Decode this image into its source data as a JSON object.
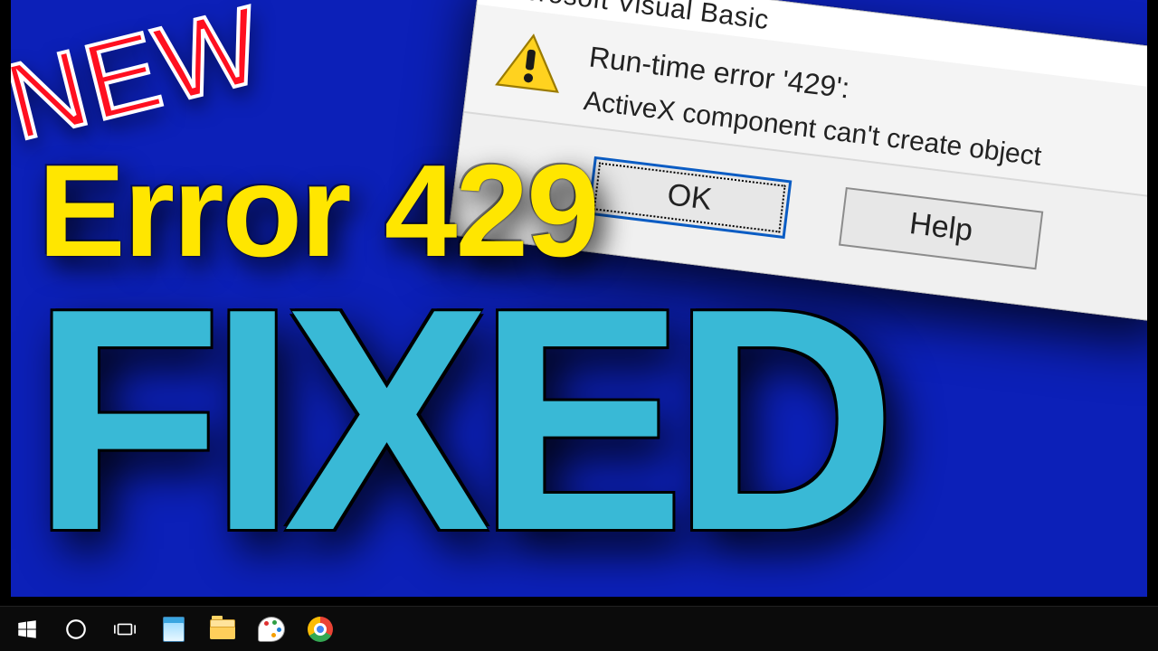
{
  "overlay": {
    "badge": "NEW",
    "headline1": "Error 429",
    "headline2": "FIXED"
  },
  "dialog": {
    "title": "Microsoft Visual Basic",
    "close_glyph": "✕",
    "error_heading": "Run-time error '429':",
    "error_body": "ActiveX component can't create object",
    "buttons": {
      "ok": "OK",
      "help": "Help"
    }
  },
  "taskbar": {
    "items": [
      {
        "name": "start",
        "hint": "Start"
      },
      {
        "name": "cortana",
        "hint": "Cortana / Search"
      },
      {
        "name": "task-view",
        "hint": "Task View"
      },
      {
        "name": "notepad",
        "hint": "Notepad"
      },
      {
        "name": "file-explorer",
        "hint": "File Explorer"
      },
      {
        "name": "paint",
        "hint": "Paint"
      },
      {
        "name": "chrome",
        "hint": "Google Chrome"
      }
    ]
  }
}
